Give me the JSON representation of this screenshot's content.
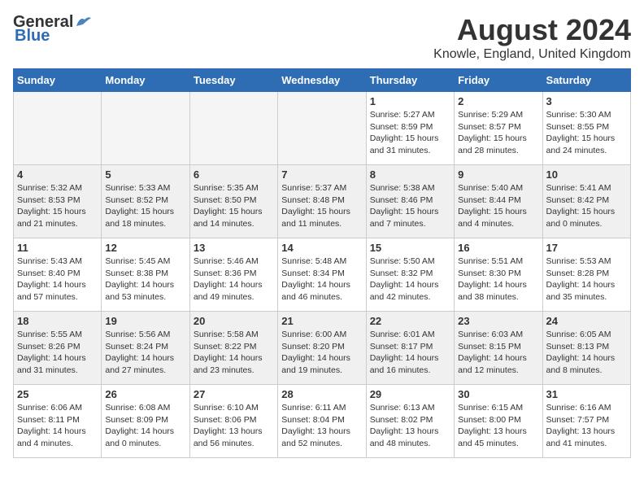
{
  "header": {
    "logo_general": "General",
    "logo_blue": "Blue",
    "month_year": "August 2024",
    "location": "Knowle, England, United Kingdom"
  },
  "weekdays": [
    "Sunday",
    "Monday",
    "Tuesday",
    "Wednesday",
    "Thursday",
    "Friday",
    "Saturday"
  ],
  "weeks": [
    [
      {
        "day": "",
        "info": ""
      },
      {
        "day": "",
        "info": ""
      },
      {
        "day": "",
        "info": ""
      },
      {
        "day": "",
        "info": ""
      },
      {
        "day": "1",
        "info": "Sunrise: 5:27 AM\nSunset: 8:59 PM\nDaylight: 15 hours\nand 31 minutes."
      },
      {
        "day": "2",
        "info": "Sunrise: 5:29 AM\nSunset: 8:57 PM\nDaylight: 15 hours\nand 28 minutes."
      },
      {
        "day": "3",
        "info": "Sunrise: 5:30 AM\nSunset: 8:55 PM\nDaylight: 15 hours\nand 24 minutes."
      }
    ],
    [
      {
        "day": "4",
        "info": "Sunrise: 5:32 AM\nSunset: 8:53 PM\nDaylight: 15 hours\nand 21 minutes."
      },
      {
        "day": "5",
        "info": "Sunrise: 5:33 AM\nSunset: 8:52 PM\nDaylight: 15 hours\nand 18 minutes."
      },
      {
        "day": "6",
        "info": "Sunrise: 5:35 AM\nSunset: 8:50 PM\nDaylight: 15 hours\nand 14 minutes."
      },
      {
        "day": "7",
        "info": "Sunrise: 5:37 AM\nSunset: 8:48 PM\nDaylight: 15 hours\nand 11 minutes."
      },
      {
        "day": "8",
        "info": "Sunrise: 5:38 AM\nSunset: 8:46 PM\nDaylight: 15 hours\nand 7 minutes."
      },
      {
        "day": "9",
        "info": "Sunrise: 5:40 AM\nSunset: 8:44 PM\nDaylight: 15 hours\nand 4 minutes."
      },
      {
        "day": "10",
        "info": "Sunrise: 5:41 AM\nSunset: 8:42 PM\nDaylight: 15 hours\nand 0 minutes."
      }
    ],
    [
      {
        "day": "11",
        "info": "Sunrise: 5:43 AM\nSunset: 8:40 PM\nDaylight: 14 hours\nand 57 minutes."
      },
      {
        "day": "12",
        "info": "Sunrise: 5:45 AM\nSunset: 8:38 PM\nDaylight: 14 hours\nand 53 minutes."
      },
      {
        "day": "13",
        "info": "Sunrise: 5:46 AM\nSunset: 8:36 PM\nDaylight: 14 hours\nand 49 minutes."
      },
      {
        "day": "14",
        "info": "Sunrise: 5:48 AM\nSunset: 8:34 PM\nDaylight: 14 hours\nand 46 minutes."
      },
      {
        "day": "15",
        "info": "Sunrise: 5:50 AM\nSunset: 8:32 PM\nDaylight: 14 hours\nand 42 minutes."
      },
      {
        "day": "16",
        "info": "Sunrise: 5:51 AM\nSunset: 8:30 PM\nDaylight: 14 hours\nand 38 minutes."
      },
      {
        "day": "17",
        "info": "Sunrise: 5:53 AM\nSunset: 8:28 PM\nDaylight: 14 hours\nand 35 minutes."
      }
    ],
    [
      {
        "day": "18",
        "info": "Sunrise: 5:55 AM\nSunset: 8:26 PM\nDaylight: 14 hours\nand 31 minutes."
      },
      {
        "day": "19",
        "info": "Sunrise: 5:56 AM\nSunset: 8:24 PM\nDaylight: 14 hours\nand 27 minutes."
      },
      {
        "day": "20",
        "info": "Sunrise: 5:58 AM\nSunset: 8:22 PM\nDaylight: 14 hours\nand 23 minutes."
      },
      {
        "day": "21",
        "info": "Sunrise: 6:00 AM\nSunset: 8:20 PM\nDaylight: 14 hours\nand 19 minutes."
      },
      {
        "day": "22",
        "info": "Sunrise: 6:01 AM\nSunset: 8:17 PM\nDaylight: 14 hours\nand 16 minutes."
      },
      {
        "day": "23",
        "info": "Sunrise: 6:03 AM\nSunset: 8:15 PM\nDaylight: 14 hours\nand 12 minutes."
      },
      {
        "day": "24",
        "info": "Sunrise: 6:05 AM\nSunset: 8:13 PM\nDaylight: 14 hours\nand 8 minutes."
      }
    ],
    [
      {
        "day": "25",
        "info": "Sunrise: 6:06 AM\nSunset: 8:11 PM\nDaylight: 14 hours\nand 4 minutes."
      },
      {
        "day": "26",
        "info": "Sunrise: 6:08 AM\nSunset: 8:09 PM\nDaylight: 14 hours\nand 0 minutes."
      },
      {
        "day": "27",
        "info": "Sunrise: 6:10 AM\nSunset: 8:06 PM\nDaylight: 13 hours\nand 56 minutes."
      },
      {
        "day": "28",
        "info": "Sunrise: 6:11 AM\nSunset: 8:04 PM\nDaylight: 13 hours\nand 52 minutes."
      },
      {
        "day": "29",
        "info": "Sunrise: 6:13 AM\nSunset: 8:02 PM\nDaylight: 13 hours\nand 48 minutes."
      },
      {
        "day": "30",
        "info": "Sunrise: 6:15 AM\nSunset: 8:00 PM\nDaylight: 13 hours\nand 45 minutes."
      },
      {
        "day": "31",
        "info": "Sunrise: 6:16 AM\nSunset: 7:57 PM\nDaylight: 13 hours\nand 41 minutes."
      }
    ]
  ]
}
